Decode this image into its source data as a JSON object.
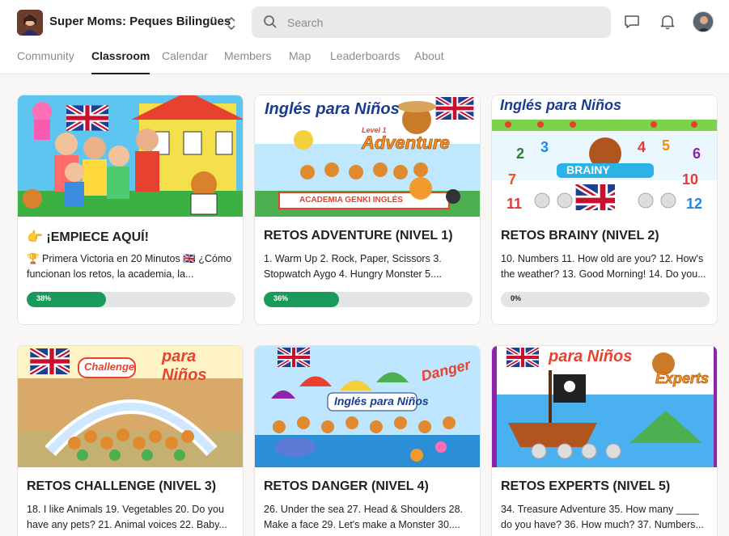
{
  "header": {
    "group_name": "Super Moms: Peques Bilingües",
    "search_placeholder": "Search"
  },
  "tabs": [
    {
      "label": "Community"
    },
    {
      "label": "Classroom"
    },
    {
      "label": "Calendar"
    },
    {
      "label": "Members"
    },
    {
      "label": "Map"
    },
    {
      "label": "Leaderboards"
    },
    {
      "label": "About"
    }
  ],
  "active_tab": "Classroom",
  "courses": [
    {
      "title": "👉 ¡EMPIECE AQUÍ!",
      "description": "🏆 Primera Victoria en 20 Minutos 🇬🇧 ¿Cómo funcionan los retos, la academia, la...",
      "progress": 38,
      "progress_label": "38%"
    },
    {
      "title": "RETOS ADVENTURE (NIVEL 1)",
      "description": "1. Warm Up 2. Rock, Paper, Scissors 3. Stopwatch Aygo 4. Hungry Monster 5....",
      "progress": 36,
      "progress_label": "36%",
      "thumb_title": "Inglés para Niños",
      "thumb_level": "Level 1",
      "thumb_subtitle": "Adventure",
      "thumb_banner": "ACADEMIA GENKI INGLÉS"
    },
    {
      "title": "RETOS BRAINY (NIVEL 2)",
      "description": "10. Numbers 11. How old are you? 12. How's the weather? 13. Good Morning! 14. Do you...",
      "progress": 0,
      "progress_label": "0%",
      "thumb_title": "Inglés para Niños",
      "thumb_subtitle": "BRAINY"
    },
    {
      "title": "RETOS CHALLENGE (NIVEL 3)",
      "description": "18. I like Animals 19. Vegetables 20. Do you have any pets? 21. Animal voices 22. Baby...",
      "thumb_title": "para Niños",
      "thumb_subtitle": "Challenge"
    },
    {
      "title": "RETOS DANGER (NIVEL 4)",
      "description": "26. Under the sea 27. Head & Shoulders 28. Make a face 29. Let's make a Monster 30....",
      "thumb_title": "Inglés para Niños",
      "thumb_subtitle": "Danger"
    },
    {
      "title": "RETOS EXPERTS (NIVEL 5)",
      "description": "34. Treasure Adventure 35. How many ____ do you have? 36. How much? 37. Numbers...",
      "thumb_title": "para Niños",
      "thumb_subtitle": "Experts"
    }
  ],
  "colors": {
    "accent": "#1a9a5a",
    "progress_track": "#e4e4e4",
    "page_bg": "#f8f7f5"
  },
  "icons": [
    "search-icon",
    "chat-icon",
    "bell-icon",
    "unfold-icon"
  ]
}
